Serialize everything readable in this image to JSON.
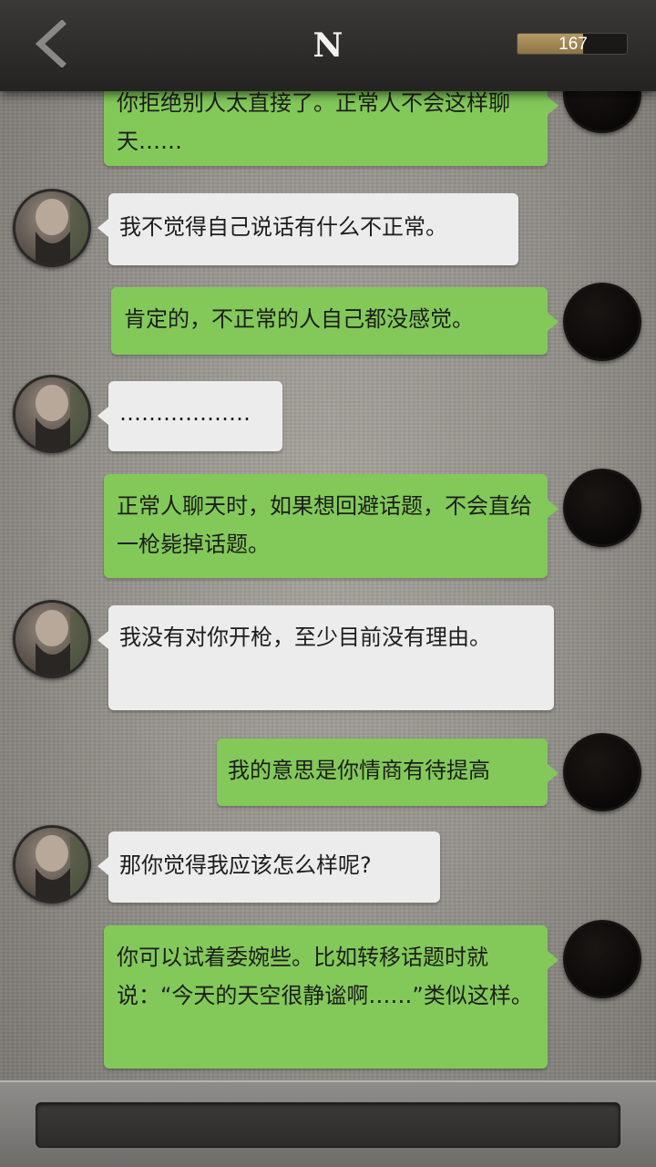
{
  "header": {
    "title": "N",
    "back_icon": "chevron-left-icon",
    "counter_value": "167",
    "counter_fill_fraction": 0.6
  },
  "colors": {
    "header_bg": "#2f2e2c",
    "bubble_self": "#83c95a",
    "bubble_other": "#ececec",
    "background": "#9a9791"
  },
  "messages": [
    {
      "sender": "self",
      "text": "你拒绝别人太直接了。正常人不会这样聊天……"
    },
    {
      "sender": "other",
      "text": "我不觉得自己说话有什么不正常。"
    },
    {
      "sender": "self",
      "text": "肯定的，不正常的人自己都没感觉。"
    },
    {
      "sender": "other",
      "text": "………………"
    },
    {
      "sender": "self",
      "text": "正常人聊天时，如果想回避话题，不会直给一枪毙掉话题。"
    },
    {
      "sender": "other",
      "text": "我没有对你开枪，至少目前没有理由。"
    },
    {
      "sender": "self",
      "text": "我的意思是你情商有待提高"
    },
    {
      "sender": "other",
      "text": "那你觉得我应该怎么样呢?"
    },
    {
      "sender": "self",
      "text": "你可以试着委婉些。比如转移话题时就说：“今天的天空很静谧啊……”类似这样。"
    }
  ],
  "input": {
    "value": ""
  }
}
